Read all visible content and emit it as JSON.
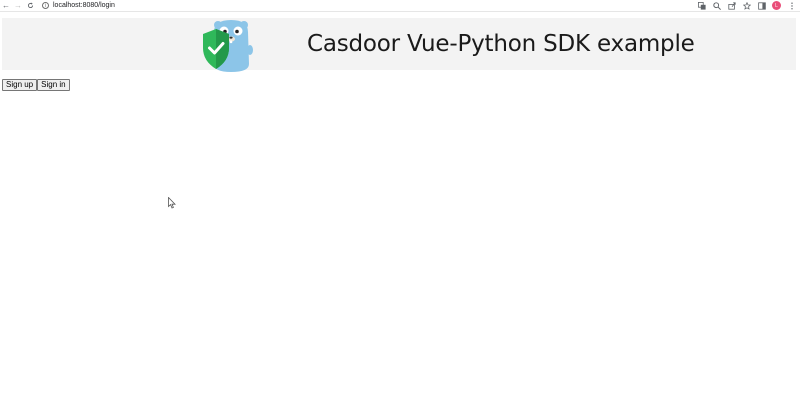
{
  "browser": {
    "back_icon": "←",
    "forward_icon": "→",
    "reload_icon": "C",
    "info_icon": "i",
    "url": "localhost:8080/login",
    "profile_initial": "L"
  },
  "header": {
    "title": "Casdoor Vue-Python SDK example"
  },
  "auth": {
    "signup_label": "Sign up",
    "signin_label": "Sign in"
  },
  "colors": {
    "banner_bg": "#f3f3f3",
    "gopher_blue": "#8cc5e8",
    "shield_green": "#2fb85a",
    "avatar_pink": "#e94f7a"
  }
}
